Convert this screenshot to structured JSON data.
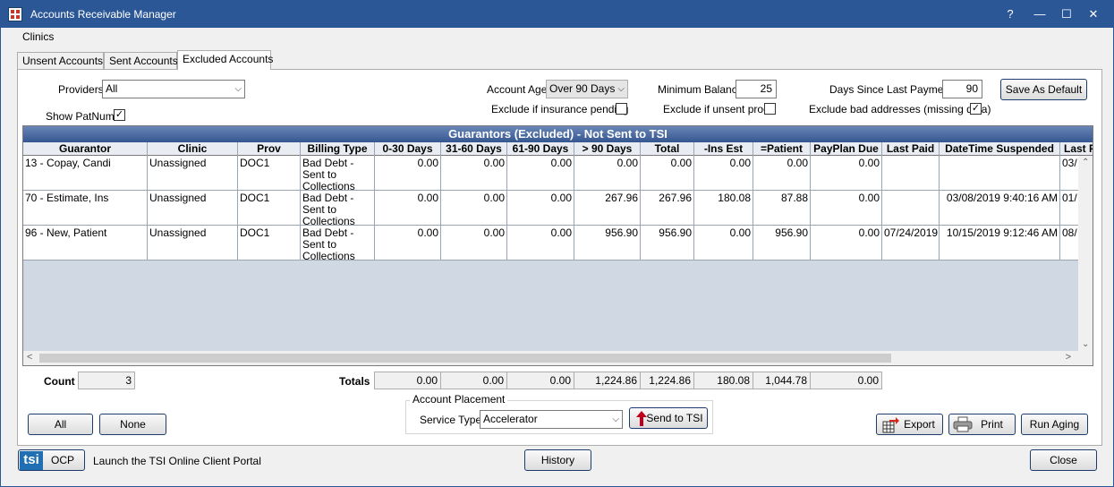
{
  "window": {
    "title": "Accounts Receivable Manager",
    "controls": {
      "help": "?",
      "minimize": "—",
      "maximize": "☐",
      "close": "✕"
    }
  },
  "menu": {
    "clinics": "Clinics"
  },
  "tabs": [
    "Unsent Accounts",
    "Sent Accounts",
    "Excluded Accounts"
  ],
  "active_tab": "Excluded Accounts",
  "filters": {
    "providers_label": "Providers",
    "providers_value": "All",
    "show_patnums_label": "Show PatNums",
    "show_patnums_checked": "✓",
    "account_age_label": "Account Age",
    "account_age_value": "Over 90 Days",
    "exclude_ins_pending_label": "Exclude if insurance pending",
    "min_balance_label": "Minimum Balance",
    "min_balance_value": "25",
    "exclude_unsent_procs_label": "Exclude if unsent procs",
    "days_since_payment_label": "Days Since Last Payment",
    "days_since_payment_value": "90",
    "exclude_bad_addresses_label": "Exclude bad addresses (missing data)",
    "exclude_bad_addresses_checked": "✓",
    "save_default_label": "Save As Default"
  },
  "grid": {
    "title": "Guarantors (Excluded) - Not Sent to TSI",
    "columns": [
      "Guarantor",
      "Clinic",
      "Prov",
      "Billing Type",
      "0-30 Days",
      "31-60 Days",
      "61-90 Days",
      "> 90 Days",
      "Total",
      "-Ins Est",
      "=Patient",
      "PayPlan Due",
      "Last Paid",
      "DateTime Suspended",
      "Last P"
    ],
    "rows": [
      [
        "13 - Copay, Candi",
        "Unassigned",
        "DOC1",
        "Bad Debt -\nSent to\nCollections",
        "0.00",
        "0.00",
        "0.00",
        "0.00",
        "0.00",
        "0.00",
        "0.00",
        "0.00",
        "",
        "",
        "03/"
      ],
      [
        "70 - Estimate, Ins",
        "Unassigned",
        "DOC1",
        "Bad Debt -\nSent to\nCollections",
        "0.00",
        "0.00",
        "0.00",
        "267.96",
        "267.96",
        "180.08",
        "87.88",
        "0.00",
        "",
        "03/08/2019 9:40:16 AM",
        "01/"
      ],
      [
        "96 - New, Patient",
        "Unassigned",
        "DOC1",
        "Bad Debt -\nSent to\nCollections",
        "0.00",
        "0.00",
        "0.00",
        "956.90",
        "956.90",
        "0.00",
        "956.90",
        "0.00",
        "07/24/2019",
        "10/15/2019 9:12:46 AM",
        "08/"
      ]
    ]
  },
  "footer": {
    "count_label": "Count",
    "count_value": "3",
    "totals_label": "Totals",
    "totals": [
      "0.00",
      "0.00",
      "0.00",
      "1,224.86",
      "1,224.86",
      "180.08",
      "1,044.78",
      "0.00"
    ],
    "all_label": "All",
    "none_label": "None",
    "account_placement_label": "Account Placement",
    "service_type_label": "Service Type",
    "service_type_value": "Accelerator",
    "send_to_tsi_label": "Send to TSI",
    "export_label": "Export",
    "print_label": "Print",
    "run_aging_label": "Run Aging",
    "tsi_logo_text": "tsi",
    "ocp_label": "OCP",
    "ocp_desc": "Launch the TSI Online Client Portal",
    "history_label": "History",
    "close_label": "Close"
  },
  "colors": {
    "titlebar": "#2b5797",
    "grid_header": "#34568f",
    "grid_empty": "#cfd8e3",
    "send_arrow": "#c0001a"
  }
}
